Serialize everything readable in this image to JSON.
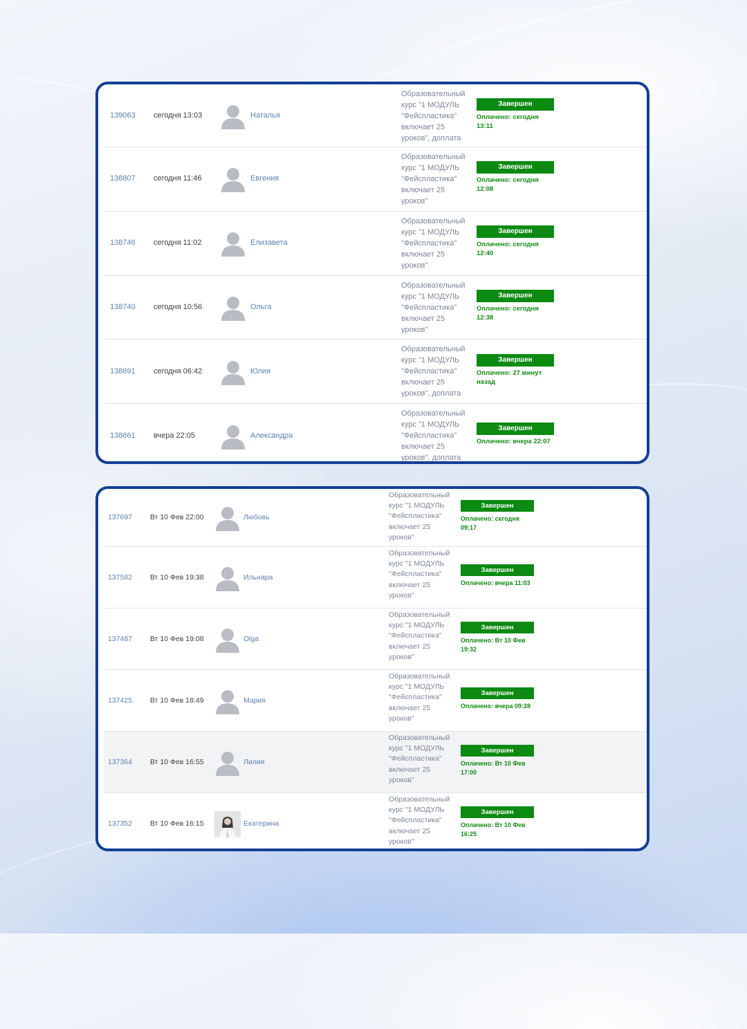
{
  "colors": {
    "panel_border": "#123f95",
    "status_green": "#0c8a12",
    "paid_text": "#138a14",
    "link_blue": "#5a7fb0"
  },
  "panels": [
    {
      "rows": [
        {
          "id": "139063",
          "date": "сегодня 13:03",
          "avatar": "default-avatar-icon",
          "name": "Наталья",
          "product": [
            "Образовательный",
            "курс \"1 МОДУЛЬ",
            "\"Фейспластика\"",
            "включает 25",
            "уроков\", доплата"
          ],
          "status": "Завершен",
          "paid": [
            "Оплачено: сегодня",
            "13:11"
          ]
        },
        {
          "id": "138807",
          "date": "сегодня 11:46",
          "avatar": "default-avatar-icon",
          "name": "Евгения",
          "product": [
            "Образовательный",
            "курс \"1 МОДУЛЬ",
            "\"Фейспластика\"",
            "включает 25",
            "уроков\""
          ],
          "status": "Завершен",
          "paid": [
            "Оплачено: сегодня",
            "12:08"
          ]
        },
        {
          "id": "138746",
          "date": "сегодня 11:02",
          "avatar": "default-avatar-icon",
          "name": "Елизавета",
          "product": [
            "Образовательный",
            "курс \"1 МОДУЛЬ",
            "\"Фейспластика\"",
            "включает 25",
            "уроков\""
          ],
          "status": "Завершен",
          "paid": [
            "Оплачено: сегодня",
            "12:40"
          ]
        },
        {
          "id": "138740",
          "date": "сегодня 10:56",
          "avatar": "default-avatar-icon",
          "name": "Ольга",
          "product": [
            "Образовательный",
            "курс \"1 МОДУЛЬ",
            "\"Фейспластика\"",
            "включает 25",
            "уроков\""
          ],
          "status": "Завершен",
          "paid": [
            "Оплачено: сегодня",
            "12:38"
          ]
        },
        {
          "id": "138691",
          "date": "сегодня 06:42",
          "avatar": "default-avatar-icon",
          "name": "Юлия",
          "product": [
            "Образовательный",
            "курс \"1 МОДУЛЬ",
            "\"Фейспластика\"",
            "включает 25",
            "уроков\", доплата"
          ],
          "status": "Завершен",
          "paid": [
            "Оплачено: 27 минут",
            "назад"
          ]
        },
        {
          "id": "138661",
          "date": "вчера 22:05",
          "avatar": "default-avatar-icon",
          "name": "Александра",
          "product": [
            "Образовательный",
            "курс \"1 МОДУЛЬ",
            "\"Фейспластика\"",
            "включает 25",
            "уроков\", доплата"
          ],
          "status": "Завершен",
          "paid": [
            "Оплачено: вчера 22:07"
          ]
        }
      ]
    },
    {
      "rows": [
        {
          "id": "137697",
          "date": "Вт 10 Фев 22:00",
          "avatar": "default-avatar-icon",
          "name": "Любовь",
          "product": [
            "Образовательный",
            "курс \"1 МОДУЛЬ",
            "\"Фейспластика\"",
            "включает 25",
            "уроков\""
          ],
          "status": "Завершен",
          "paid": [
            "Оплачено: сегодня",
            "09:17"
          ]
        },
        {
          "id": "137582",
          "date": "Вт 10 Фев 19:38",
          "avatar": "default-avatar-icon",
          "name": "Ильнара",
          "product": [
            "Образовательный",
            "курс \"1 МОДУЛЬ",
            "\"Фейспластика\"",
            "включает 25",
            "уроков\""
          ],
          "status": "Завершен",
          "paid": [
            "Оплачено: вчера 11:03"
          ]
        },
        {
          "id": "137487",
          "date": "Вт 10 Фев 19:08",
          "avatar": "default-avatar-icon",
          "name": "Olga",
          "product": [
            "Образовательный",
            "курс \"1 МОДУЛЬ",
            "\"Фейспластика\"",
            "включает 25",
            "уроков\""
          ],
          "status": "Завершен",
          "paid": [
            "Оплачено: Вт 10 Фев",
            "19:32"
          ]
        },
        {
          "id": "137425",
          "date": "Вт 10 Фев 18:49",
          "avatar": "default-avatar-icon",
          "name": "Мария",
          "product": [
            "Образовательный",
            "курс \"1 МОДУЛЬ",
            "\"Фейспластика\"",
            "включает 25",
            "уроков\""
          ],
          "status": "Завершен",
          "paid": [
            "Оплачено: вчера 09:28"
          ]
        },
        {
          "id": "137364",
          "date": "Вт 10 Фев 16:55",
          "avatar": "default-avatar-icon",
          "name": "Лилия",
          "product": [
            "Образовательный",
            "курс \"1 МОДУЛЬ",
            "\"Фейспластика\"",
            "включает 25",
            "уроков\""
          ],
          "status": "Завершен",
          "paid": [
            "Оплачено: Вт 10 Фев",
            "17:00"
          ]
        },
        {
          "id": "137352",
          "date": "Вт 10 Фев 16:15",
          "avatar": "photo-avatar",
          "name": "Екатерина",
          "product": [
            "Образовательный",
            "курс \"1 МОДУЛЬ",
            "\"Фейспластика\"",
            "включает 25",
            "уроков\""
          ],
          "status": "Завершен",
          "paid": [
            "Оплачено: Вт 10 Фев",
            "16:25"
          ]
        }
      ]
    }
  ]
}
